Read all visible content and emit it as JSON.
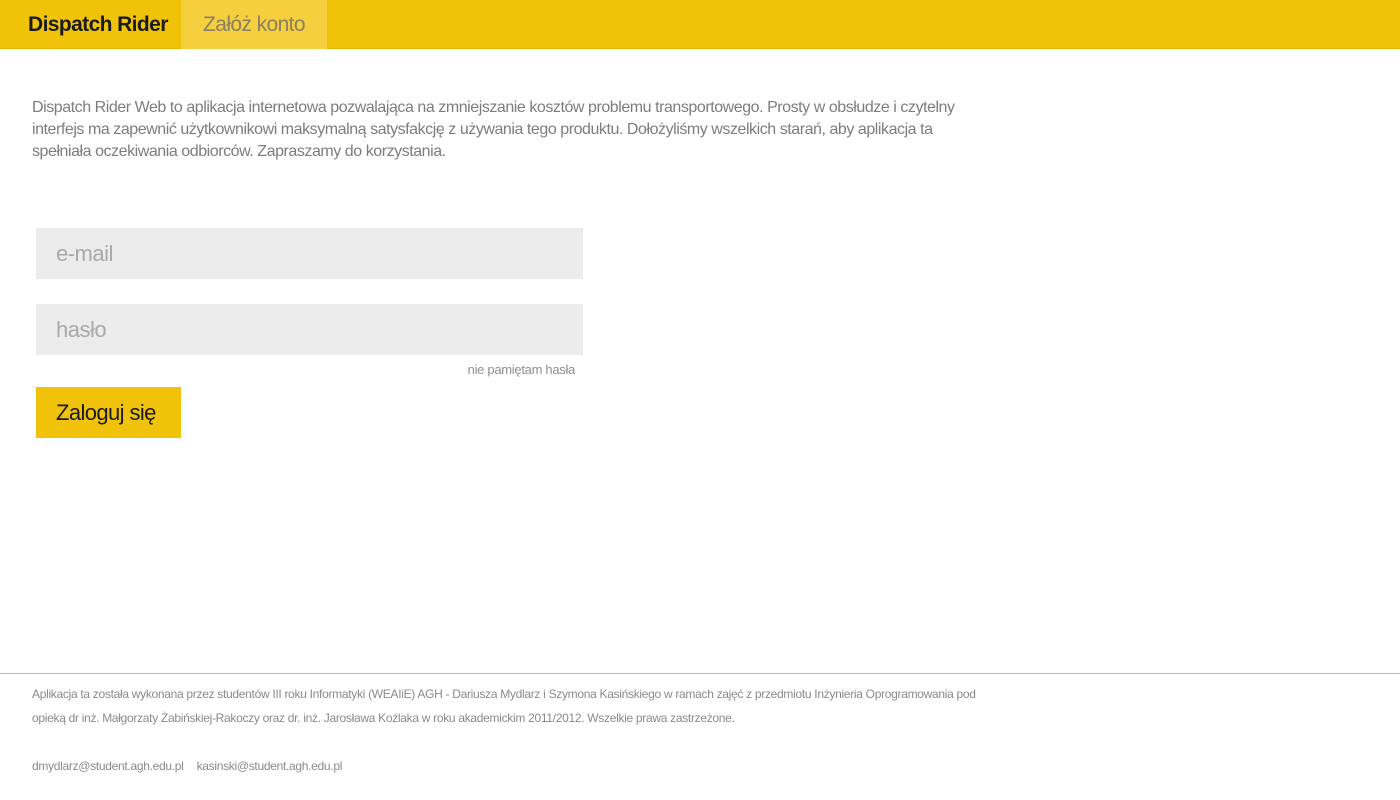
{
  "header": {
    "brand": "Dispatch Rider",
    "nav_register": "Załóż konto"
  },
  "intro": {
    "text": "Dispatch Rider Web to aplikacja internetowa pozwalająca na zmniejszanie kosztów problemu transportowego. Prosty w obsłudze i czytelny interfejs ma zapewnić użytkownikowi maksymalną satysfakcję z używania tego produktu. Dołożyliśmy wszelkich starań, aby aplikacja ta spełniała oczekiwania odbiorców.  Zapraszamy do korzystania."
  },
  "login_form": {
    "email_placeholder": "e-mail",
    "email_value": "",
    "password_placeholder": "hasło",
    "password_value": "",
    "forgot_password": "nie pamiętam hasła",
    "submit_label": "Zaloguj się"
  },
  "footer": {
    "text": "Aplikacja ta została wykonana przez studentów III roku Informatyki  (WEAIiE) AGH - Dariusza Mydlarz i Szymona Kasińskiego w ramach zajęć z przedmiotu Inżynieria Oprogramowania pod opieką dr inż.  Małgorzaty Żabińskiej-Rakoczy oraz dr. inż. Jarosława Koźlaka w roku akademickim 2011/2012. Wszelkie prawa zastrzeżone.",
    "contacts": [
      "dmydlarz@student.agh.edu.pl",
      "kasinski@student.agh.edu.pl"
    ]
  },
  "colors": {
    "accent": "#f0c30a",
    "tab_active": "#f5cf3d",
    "text_muted": "#7d7d7d",
    "input_bg": "#ececec"
  }
}
